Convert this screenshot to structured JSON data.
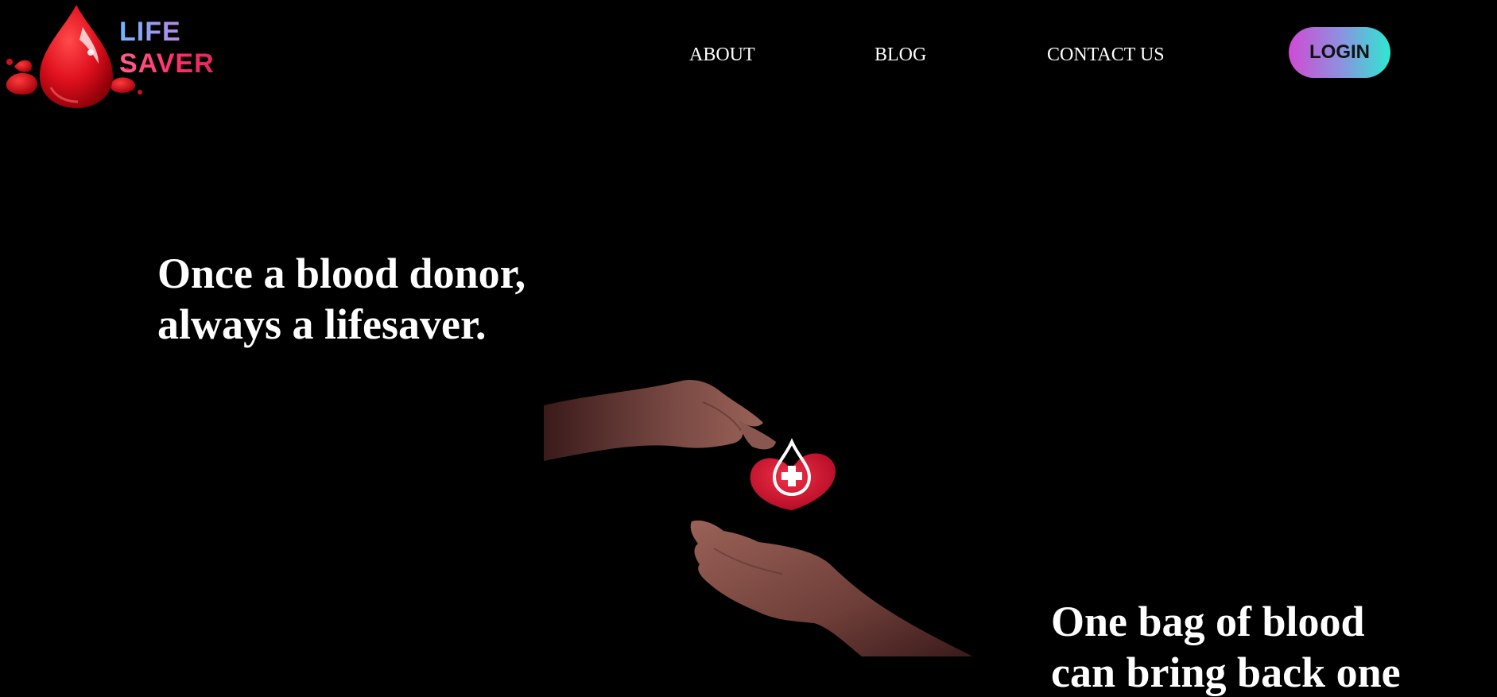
{
  "header": {
    "logo": {
      "line1": "LIFE",
      "line2": "SAVER",
      "icon": "blood-drop-icon"
    },
    "nav": [
      {
        "label": "ABOUT"
      },
      {
        "label": "BLOG"
      },
      {
        "label": "CONTACT US"
      }
    ],
    "login_label": "LOGIN"
  },
  "hero": {
    "headline_1": {
      "line1": "Once a blood donor,",
      "line2": "always a lifesaver."
    },
    "headline_2": {
      "line1": "One bag of blood",
      "line2": "can bring back one"
    },
    "image_icon": "hands-heart-blood-drop-icon"
  },
  "colors": {
    "background": "#000000",
    "text": "#ffffff",
    "brand_red": "#e0142b",
    "login_gradient_start": "#cf4bd2",
    "login_gradient_end": "#2ee8d0"
  }
}
